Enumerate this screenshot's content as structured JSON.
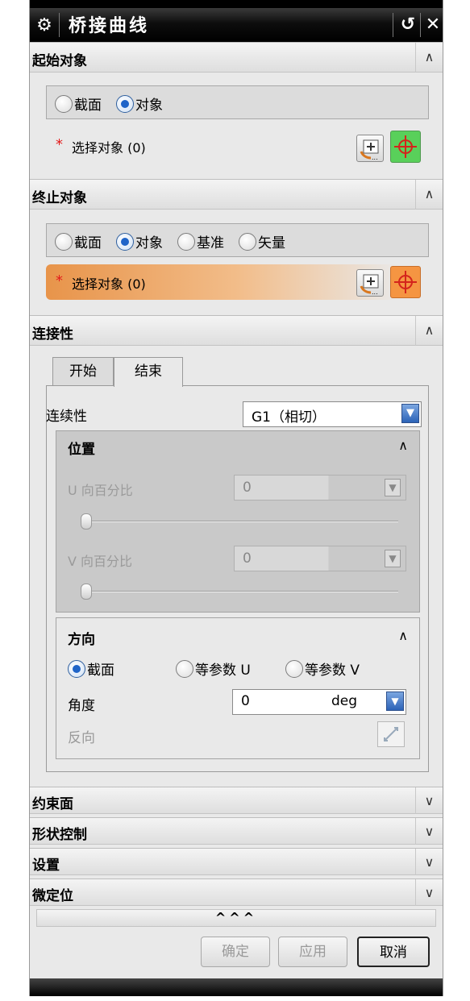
{
  "window": {
    "title": "桥接曲线",
    "reset_glyph": "↺",
    "close_glyph": "✕"
  },
  "sections": {
    "start": {
      "title": "起始对象",
      "radios": [
        "截面",
        "对象"
      ],
      "selected": "对象",
      "select_label": "选择对象 (0)",
      "required_mark": "*"
    },
    "end": {
      "title": "终止对象",
      "radios": [
        "截面",
        "对象",
        "基准",
        "矢量"
      ],
      "selected": "对象",
      "select_label": "选择对象 (0)",
      "required_mark": "*"
    },
    "connectivity": {
      "title": "连接性",
      "tabs": [
        "开始",
        "结束"
      ],
      "active_tab": "结束",
      "continuity_label": "连续性",
      "continuity_value": "G1（相切）",
      "position": {
        "title": "位置",
        "u_label": "U 向百分比",
        "u_value": "0",
        "v_label": "V 向百分比",
        "v_value": "0"
      },
      "direction": {
        "title": "方向",
        "radios": [
          "截面",
          "等参数 U",
          "等参数 V"
        ],
        "selected": "截面",
        "angle_label": "角度",
        "angle_value": "0",
        "angle_unit": "deg",
        "reverse_label": "反向"
      }
    },
    "collapsed": [
      "约束面",
      "形状控制",
      "设置",
      "微定位"
    ]
  },
  "more_toggle": "^^^",
  "buttons": {
    "ok": "确定",
    "apply": "应用",
    "cancel": "取消"
  },
  "colors": {
    "select_highlight": "#e8944a",
    "crosshair_green": "#59d05a",
    "crosshair_orange": "#f59542",
    "radio_on": "#1f64c8"
  }
}
